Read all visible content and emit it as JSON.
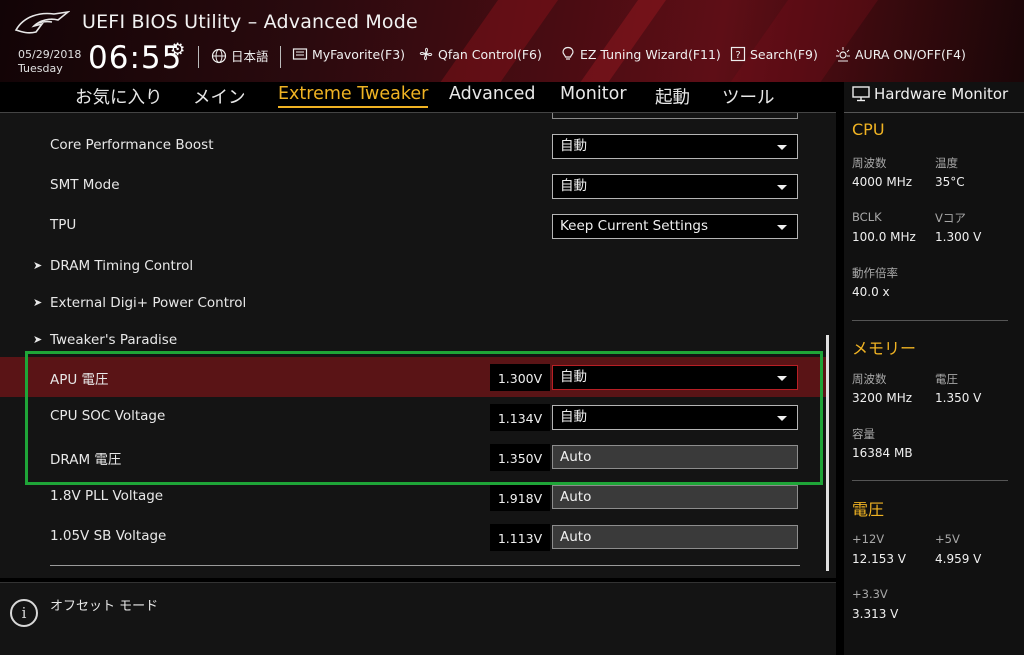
{
  "header": {
    "title": "UEFI BIOS Utility – Advanced Mode",
    "date": "05/29/2018",
    "day": "Tuesday",
    "time": "06:55",
    "buttons": [
      {
        "icon": "globe-icon",
        "label": "日本語"
      },
      {
        "icon": "favorite-icon",
        "label": "MyFavorite(F3)"
      },
      {
        "icon": "fan-icon",
        "label": "Qfan Control(F6)"
      },
      {
        "icon": "lightbulb-icon",
        "label": "EZ Tuning Wizard(F11)"
      },
      {
        "icon": "help-icon",
        "label": "Search(F9)"
      },
      {
        "icon": "aura-icon",
        "label": "AURA ON/OFF(F4)"
      }
    ]
  },
  "tabs": [
    {
      "label": "お気に入り"
    },
    {
      "label": "メイン"
    },
    {
      "label": "Extreme Tweaker",
      "active": true
    },
    {
      "label": "Advanced"
    },
    {
      "label": "Monitor"
    },
    {
      "label": "起動"
    },
    {
      "label": "ツール"
    }
  ],
  "settings": [
    {
      "label": "Core Performance Boost",
      "type": "select",
      "value": "自動"
    },
    {
      "label": "SMT Mode",
      "type": "select",
      "value": "自動"
    },
    {
      "label": "TPU",
      "type": "select",
      "value": "Keep Current Settings"
    },
    {
      "label": "DRAM Timing Control",
      "type": "submenu"
    },
    {
      "label": "External Digi+ Power Control",
      "type": "submenu"
    },
    {
      "label": "Tweaker's Paradise",
      "type": "submenu"
    },
    {
      "label": "APU 電圧",
      "type": "select",
      "reading": "1.300V",
      "value": "自動",
      "highlighted": true
    },
    {
      "label": "CPU SOC Voltage",
      "type": "select",
      "reading": "1.134V",
      "value": "自動"
    },
    {
      "label": "DRAM 電圧",
      "type": "input",
      "reading": "1.350V",
      "value": "Auto"
    },
    {
      "label": "1.8V PLL Voltage",
      "type": "input",
      "reading": "1.918V",
      "value": "Auto"
    },
    {
      "label": "1.05V SB Voltage",
      "type": "input",
      "reading": "1.113V",
      "value": "Auto"
    }
  ],
  "help": {
    "text": "オフセット モード"
  },
  "hardware_monitor": {
    "title": "Hardware Monitor",
    "cpu": {
      "title": "CPU",
      "freq_label": "周波数",
      "freq": "4000 MHz",
      "temp_label": "温度",
      "temp": "35°C",
      "bclk_label": "BCLK",
      "bclk": "100.0 MHz",
      "vcore_label": "Vコア",
      "vcore": "1.300 V",
      "ratio_label": "動作倍率",
      "ratio": "40.0 x"
    },
    "memory": {
      "title": "メモリー",
      "freq_label": "周波数",
      "freq": "3200 MHz",
      "volt_label": "電圧",
      "volt": "1.350 V",
      "cap_label": "容量",
      "cap": "16384 MB"
    },
    "voltage": {
      "title": "電圧",
      "v12_label": "+12V",
      "v12": "12.153 V",
      "v5_label": "+5V",
      "v5": "4.959 V",
      "v33_label": "+3.3V",
      "v33": "3.313 V"
    }
  },
  "colors": {
    "accent": "#f0b323",
    "highlight_row": "#5a1416",
    "annotation_box": "#1fa538"
  }
}
